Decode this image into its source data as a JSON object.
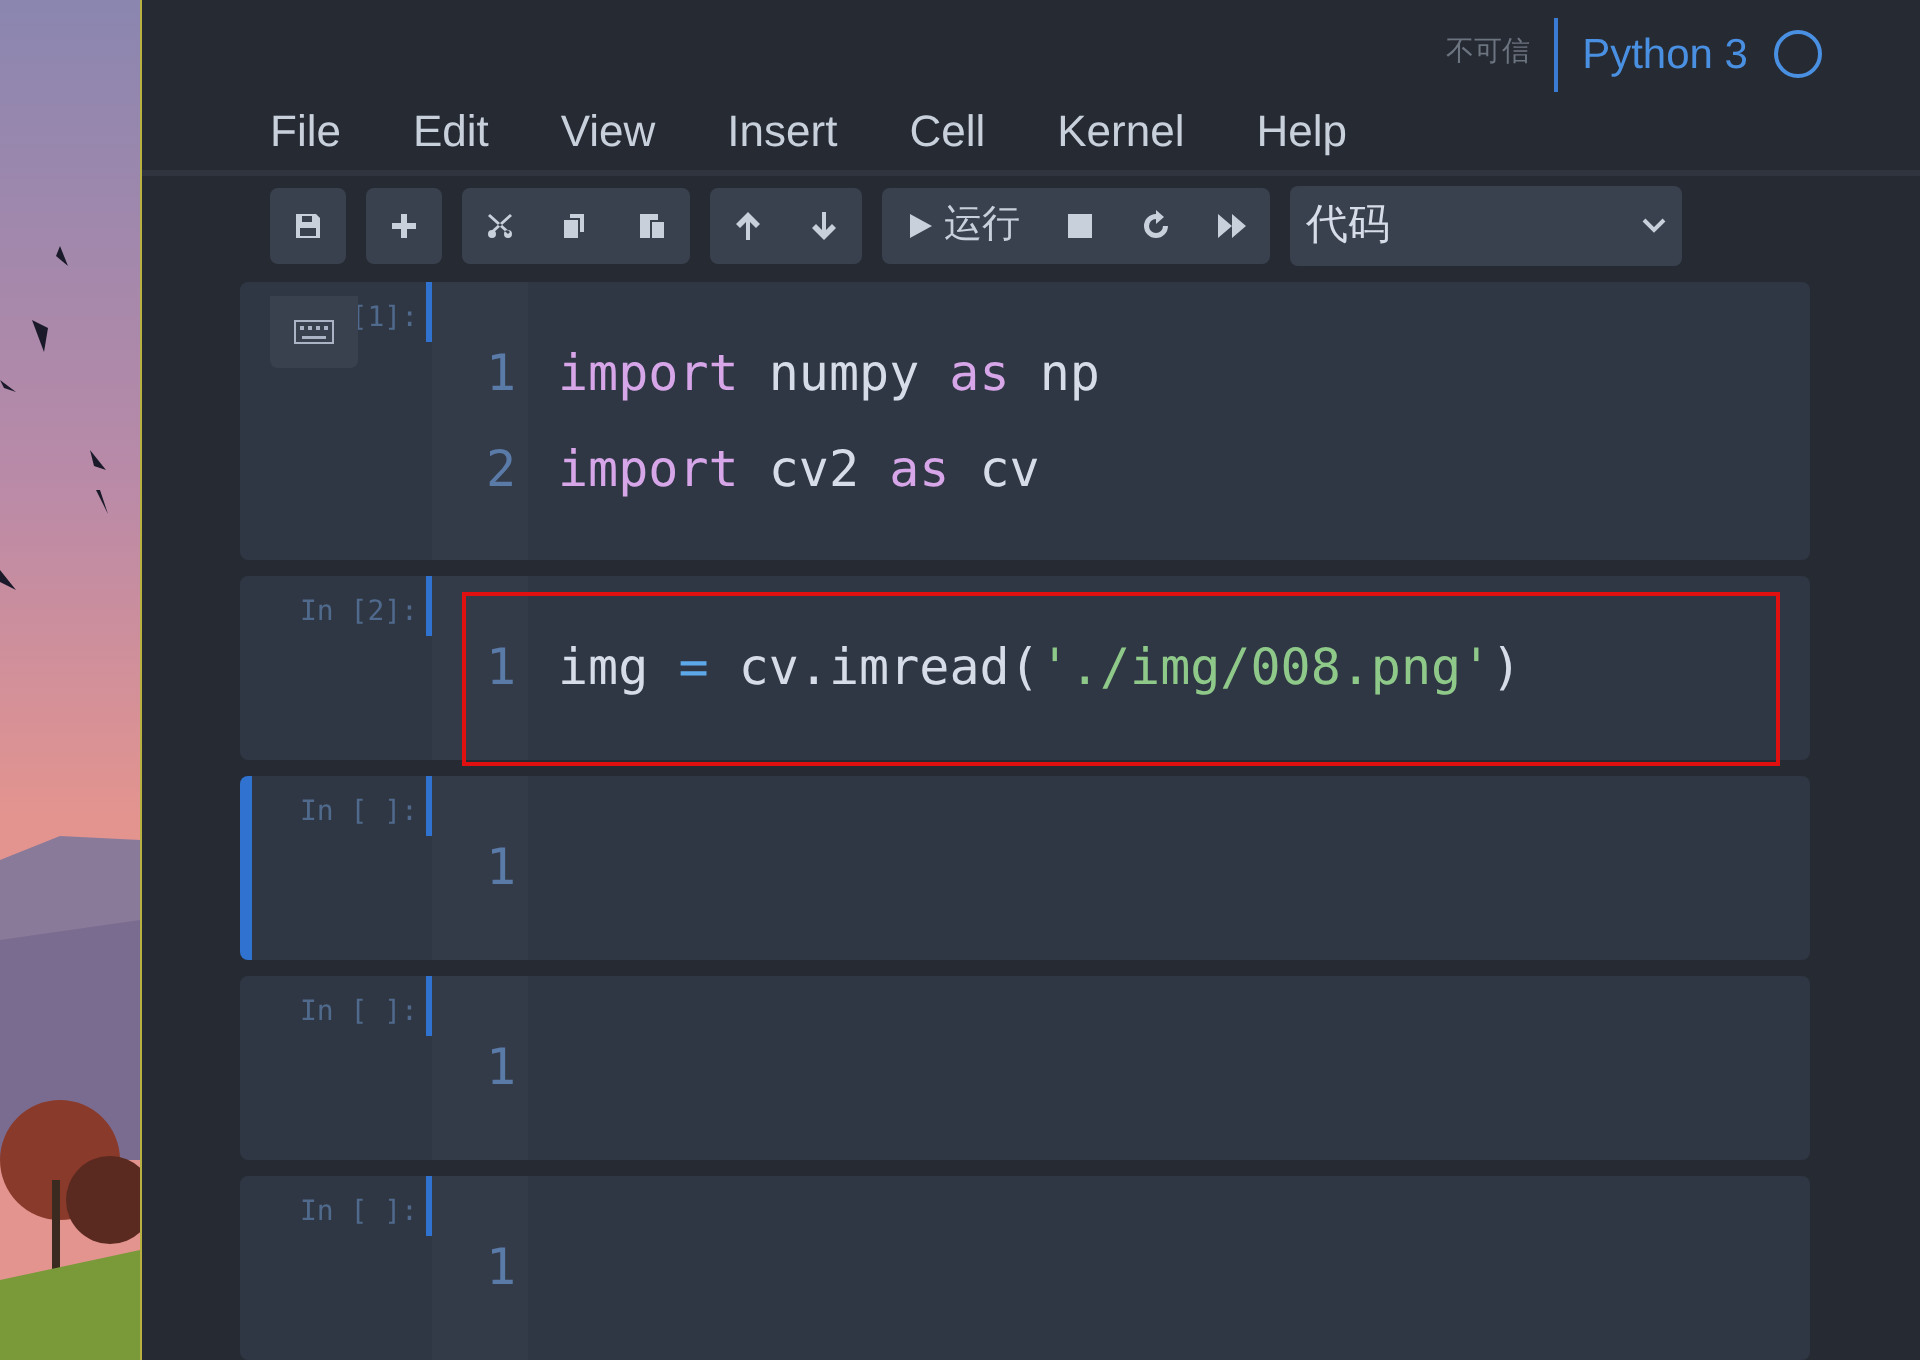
{
  "header": {
    "trust": "不可信",
    "kernel": "Python 3"
  },
  "menu": [
    "File",
    "Edit",
    "View",
    "Insert",
    "Cell",
    "Kernel",
    "Help"
  ],
  "toolbar": {
    "run_label": "运行",
    "cell_type": "代码"
  },
  "cells": [
    {
      "prompt": "[1]:",
      "selected": false,
      "highlighted": false,
      "lines": [
        {
          "number": "1",
          "tokens": [
            {
              "text": "import",
              "kind": "keyword"
            },
            {
              "text": " numpy ",
              "kind": "name"
            },
            {
              "text": "as",
              "kind": "keyword"
            },
            {
              "text": " np",
              "kind": "name"
            }
          ]
        },
        {
          "number": "2",
          "tokens": [
            {
              "text": "import",
              "kind": "keyword"
            },
            {
              "text": " cv2 ",
              "kind": "name"
            },
            {
              "text": "as",
              "kind": "keyword"
            },
            {
              "text": " cv",
              "kind": "name"
            }
          ]
        }
      ]
    },
    {
      "prompt": "In [2]:",
      "selected": false,
      "highlighted": true,
      "lines": [
        {
          "number": "1",
          "tokens": [
            {
              "text": "img ",
              "kind": "name"
            },
            {
              "text": "=",
              "kind": "operator"
            },
            {
              "text": " cv.imread(",
              "kind": "name"
            },
            {
              "text": "'./img/008.png'",
              "kind": "string"
            },
            {
              "text": ")",
              "kind": "name"
            }
          ]
        }
      ]
    },
    {
      "prompt": "In [ ]:",
      "selected": true,
      "highlighted": false,
      "lines": [
        {
          "number": "1"
        }
      ]
    },
    {
      "prompt": "In [ ]:",
      "selected": false,
      "highlighted": false,
      "lines": [
        {
          "number": "1"
        }
      ]
    },
    {
      "prompt": "In [ ]:",
      "selected": false,
      "highlighted": false,
      "lines": [
        {
          "number": "1"
        }
      ]
    }
  ]
}
